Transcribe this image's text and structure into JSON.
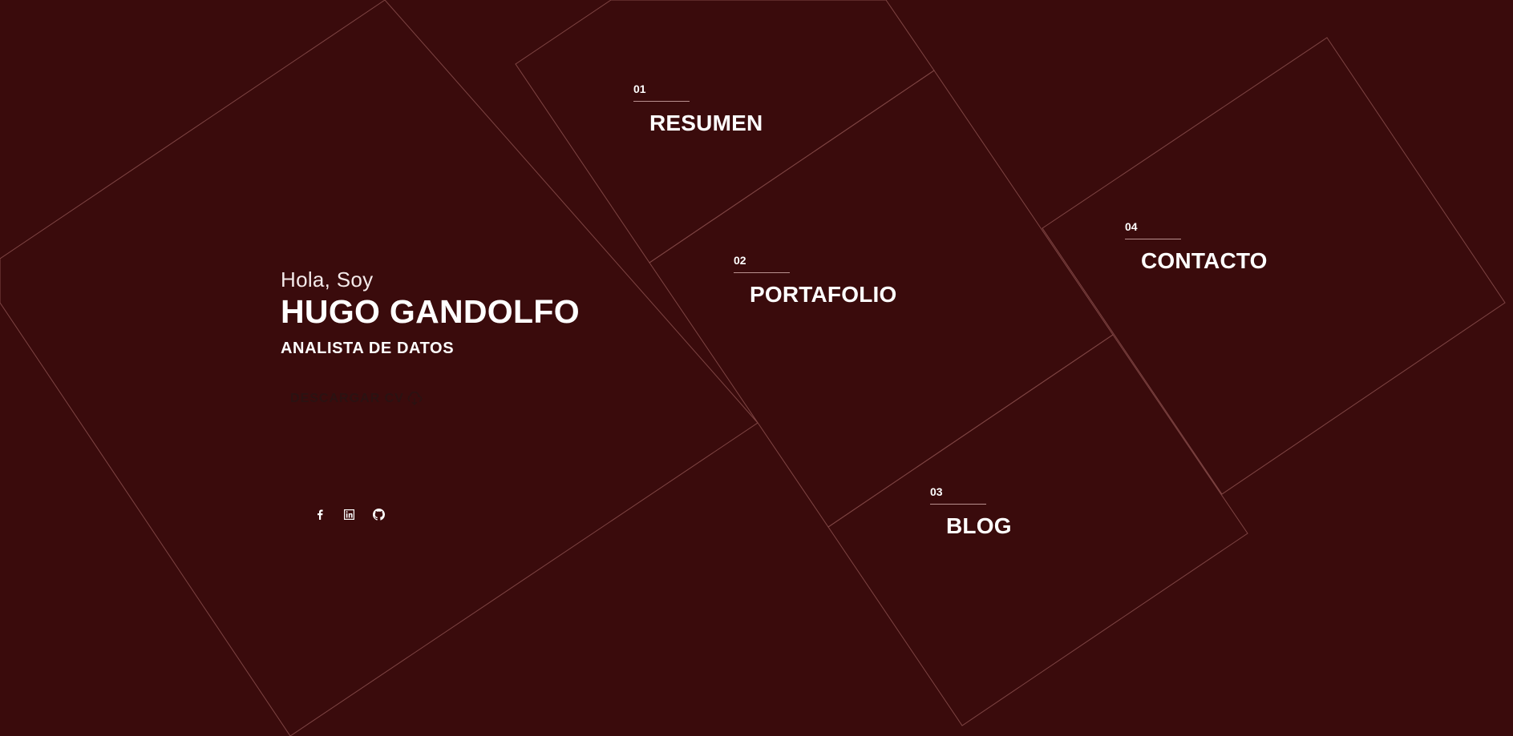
{
  "colors": {
    "background": "#3a0b0c",
    "line": "#8a4f4d",
    "text": "#ffffff",
    "download_text": "#2a1212"
  },
  "hero": {
    "greeting": "Hola, Soy",
    "name": "HUGO GANDOLFO",
    "role": "ANALISTA DE DATOS",
    "download_label": "DESCARGAR CV",
    "download_icon": "download-icon"
  },
  "socials": [
    {
      "icon": "facebook-icon"
    },
    {
      "icon": "linkedin-icon"
    },
    {
      "icon": "github-icon"
    }
  ],
  "nav": [
    {
      "number": "01",
      "label": "RESUMEN"
    },
    {
      "number": "02",
      "label": "PORTAFOLIO"
    },
    {
      "number": "03",
      "label": "BLOG"
    },
    {
      "number": "04",
      "label": "CONTACTO"
    }
  ]
}
